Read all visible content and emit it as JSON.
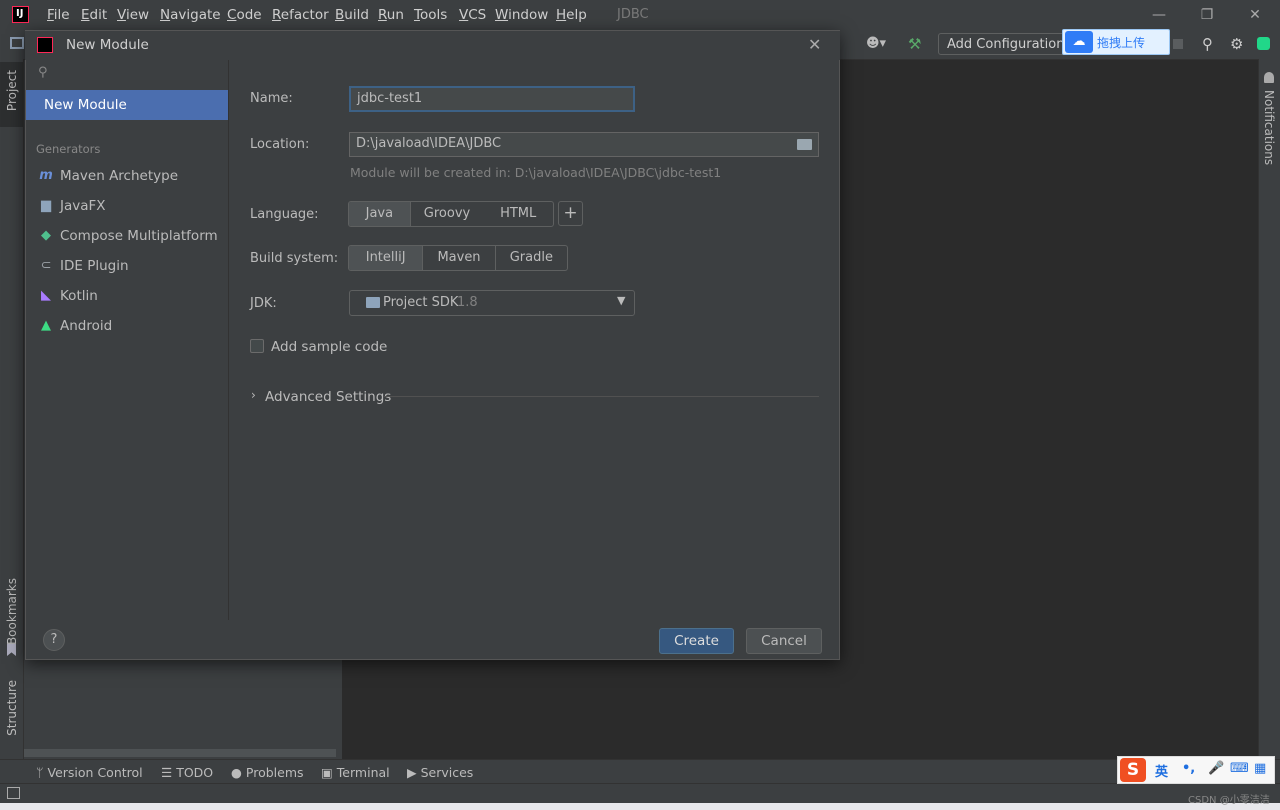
{
  "window": {
    "title": "JDBC",
    "menu": [
      "File",
      "Edit",
      "View",
      "Navigate",
      "Code",
      "Refactor",
      "Build",
      "Run",
      "Tools",
      "VCS",
      "Window",
      "Help"
    ],
    "controls": {
      "minimize": "—",
      "restore": "❐",
      "close": "✕"
    }
  },
  "toolbar": {
    "add_configuration": "Add Configuration.",
    "baidu_upload": "拖拽上传"
  },
  "left_stripe": {
    "project": "Project",
    "bookmarks": "Bookmarks",
    "structure": "Structure"
  },
  "right_stripe": {
    "notifications": "Notifications"
  },
  "dialog": {
    "title": "New Module",
    "search_placeholder": "",
    "nav": {
      "selected": "New Module",
      "section": "Generators",
      "items": [
        {
          "label": "Maven Archetype",
          "icon": "maven-icon",
          "glyph": "m",
          "color": "#6a8fd8"
        },
        {
          "label": "JavaFX",
          "icon": "folder-icon",
          "glyph": "▆",
          "color": "#8ea4bb"
        },
        {
          "label": "Compose Multiplatform",
          "icon": "compose-icon",
          "glyph": "◆",
          "color": "#4fc08d"
        },
        {
          "label": "IDE Plugin",
          "icon": "plugin-icon",
          "glyph": "⊂",
          "color": "#9aa0a6"
        },
        {
          "label": "Kotlin",
          "icon": "kotlin-icon",
          "glyph": "◣",
          "color": "#a97bff"
        },
        {
          "label": "Android",
          "icon": "android-icon",
          "glyph": "▲",
          "color": "#3ddc84"
        }
      ]
    },
    "form": {
      "name_label": "Name:",
      "name_value": "jdbc-test1",
      "location_label": "Location:",
      "location_value": "D:\\javaload\\IDEA\\JDBC",
      "location_hint": "Module will be created in: D:\\javaload\\IDEA\\JDBC\\jdbc-test1",
      "language_label": "Language:",
      "languages": [
        "Java",
        "Groovy",
        "HTML"
      ],
      "language_selected": "Java",
      "add_language": "+",
      "build_label": "Build system:",
      "build_systems": [
        "IntelliJ",
        "Maven",
        "Gradle"
      ],
      "build_selected": "IntelliJ",
      "jdk_label": "JDK:",
      "jdk_name": "Project SDK",
      "jdk_version": "1.8",
      "sample_code_label": "Add sample code",
      "sample_code_checked": false,
      "advanced_label": "Advanced Settings"
    },
    "help": "?",
    "create": "Create",
    "cancel": "Cancel"
  },
  "bottom_tools": [
    {
      "label": "Version Control",
      "icon": "branch-icon",
      "glyph": "ᛘ"
    },
    {
      "label": "TODO",
      "icon": "list-icon",
      "glyph": "☰"
    },
    {
      "label": "Problems",
      "icon": "problems-icon",
      "glyph": "●"
    },
    {
      "label": "Terminal",
      "icon": "terminal-icon",
      "glyph": "▣"
    },
    {
      "label": "Services",
      "icon": "services-icon",
      "glyph": "▶"
    }
  ],
  "ime": {
    "logo": "S",
    "lang": "英",
    "punct": "•,"
  },
  "watermark": "CSDN @小零洁洁",
  "colors": {
    "accent_selected": "#4b6eaf",
    "primary_button": "#365880",
    "background": "#3c3f41"
  }
}
